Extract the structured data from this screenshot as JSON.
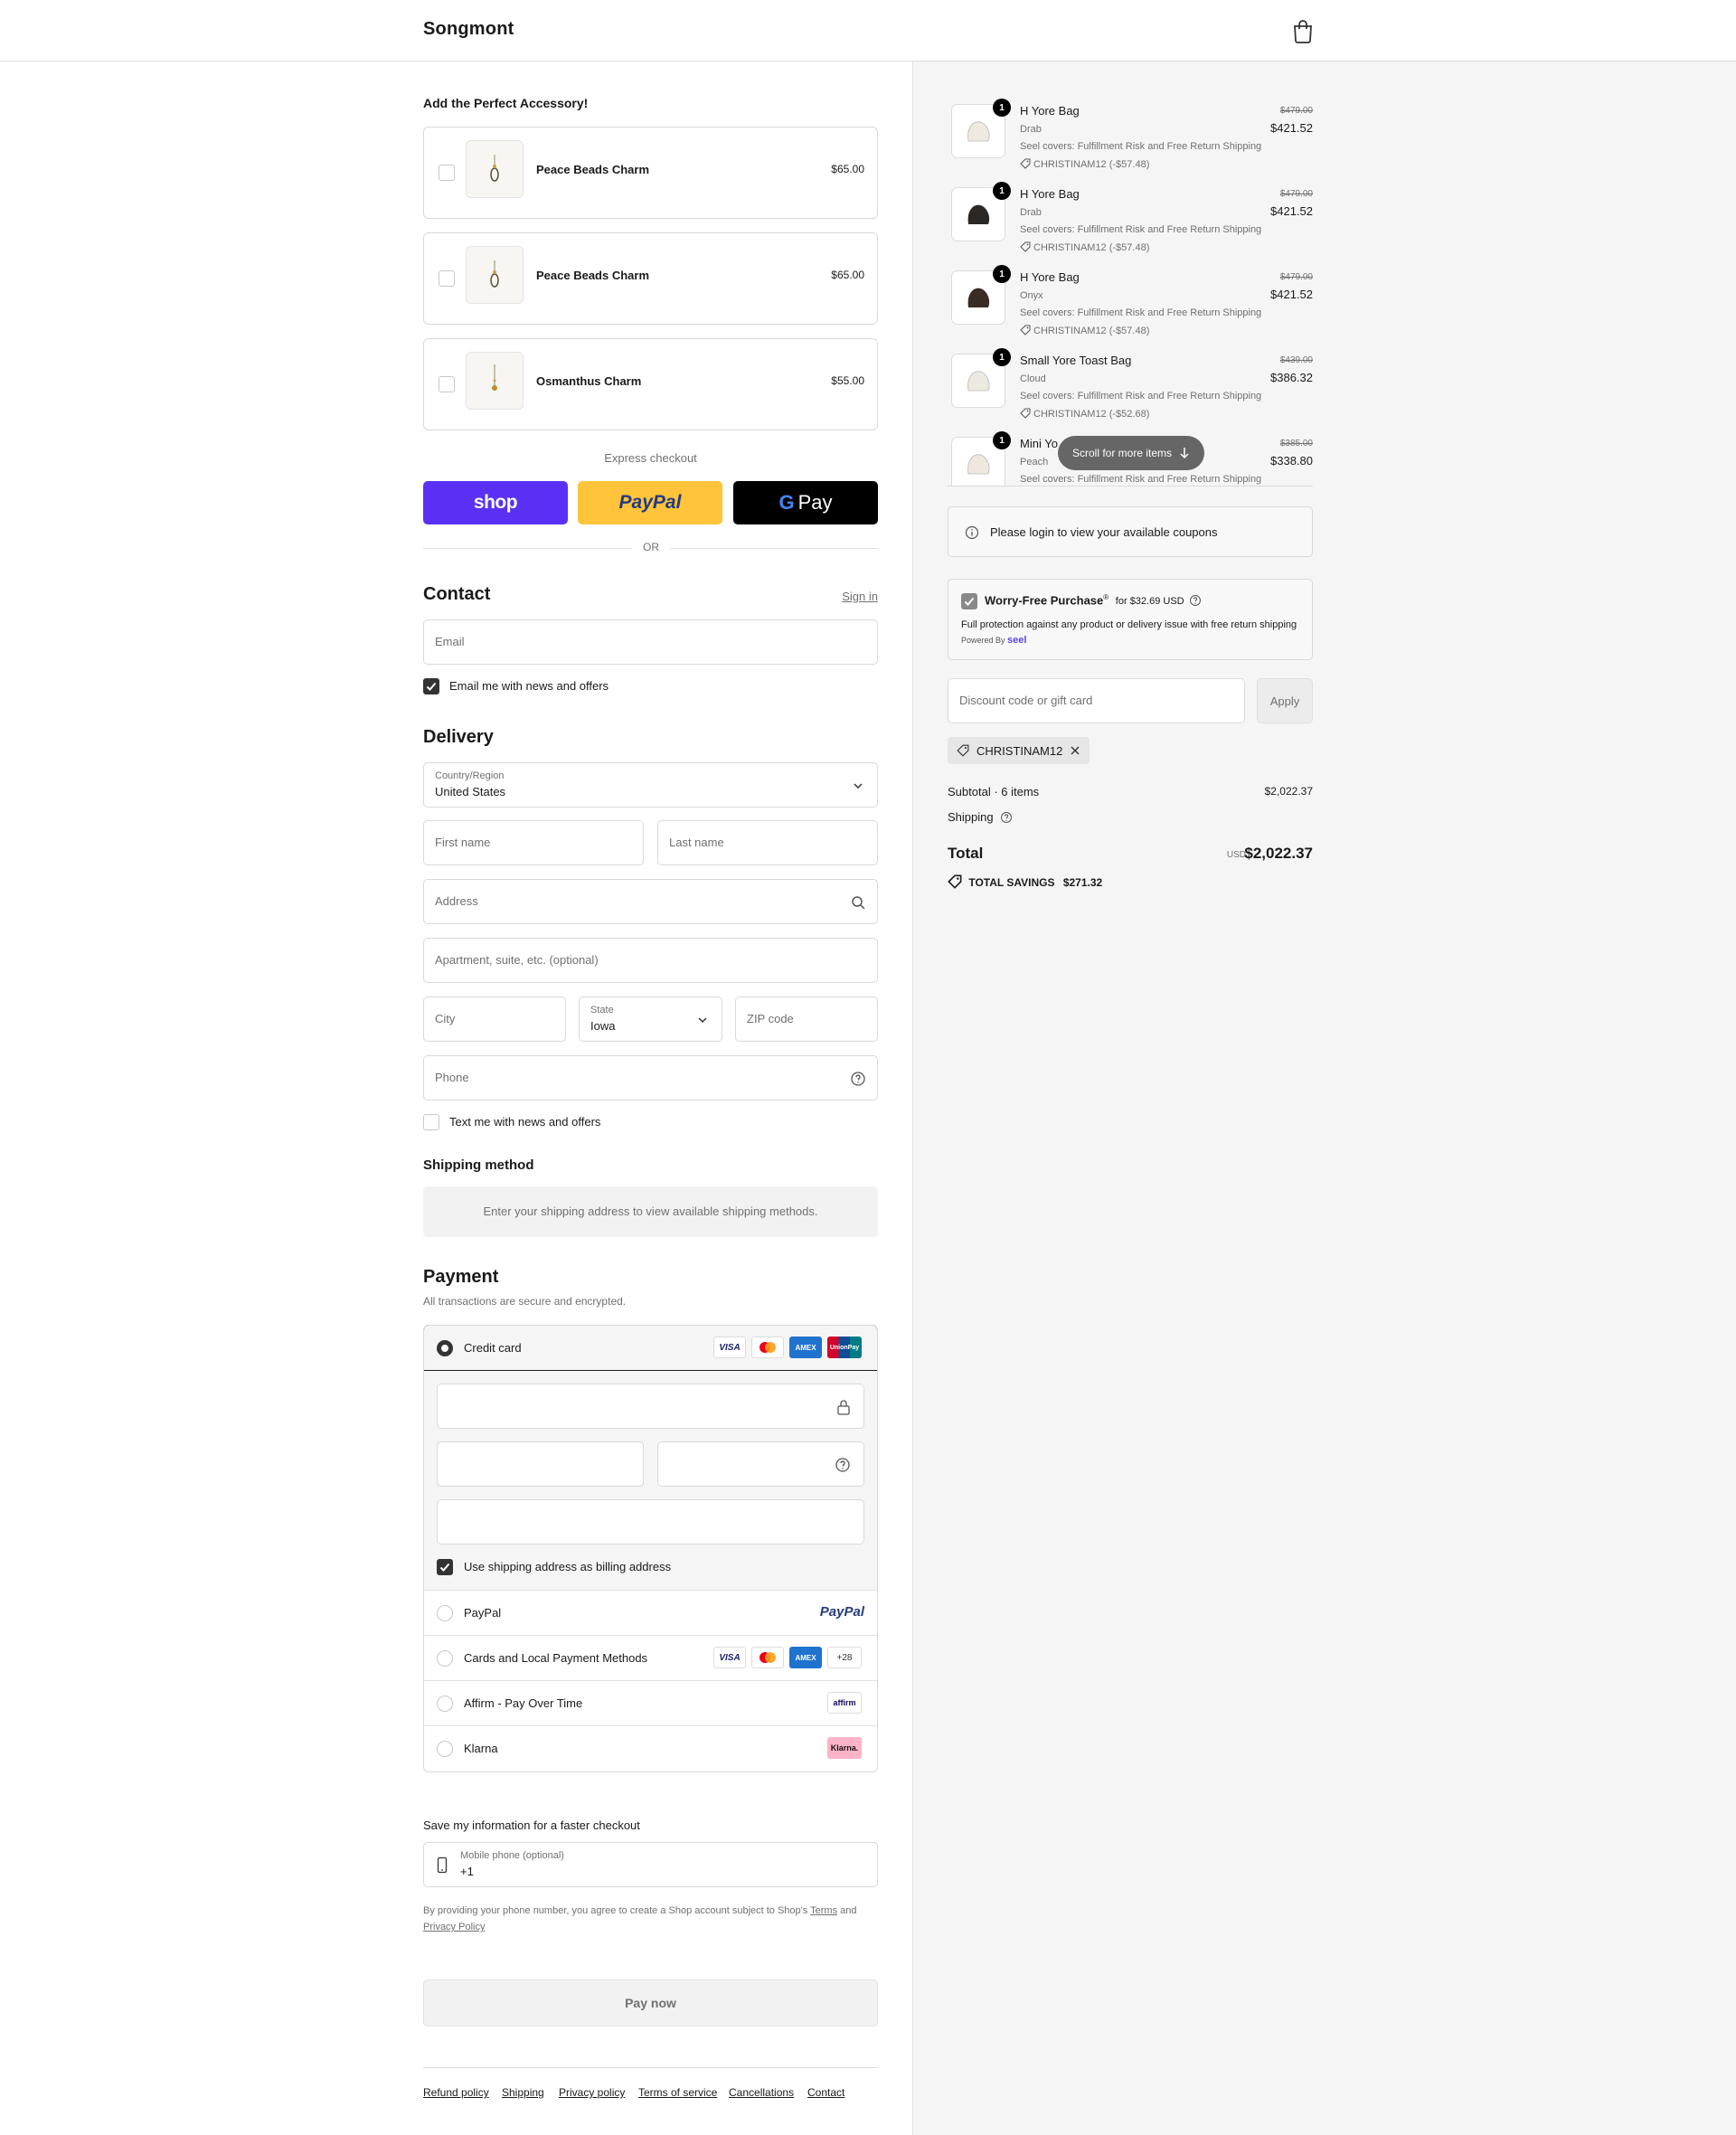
{
  "header": {
    "brand": "Songmont"
  },
  "accessories": {
    "title": "Add the Perfect Accessory!",
    "items": [
      {
        "name": "Peace Beads Charm",
        "price": "$65.00"
      },
      {
        "name": "Peace Beads Charm",
        "price": "$65.00"
      },
      {
        "name": "Osmanthus Charm",
        "price": "$55.00"
      }
    ]
  },
  "express": {
    "label": "Express checkout",
    "shop": "shop",
    "paypal": "PayPal",
    "gpay": "Pay",
    "or": "OR"
  },
  "contact": {
    "title": "Contact",
    "sign_in": "Sign in",
    "email_placeholder": "Email",
    "email_news": "Email me with news and offers"
  },
  "delivery": {
    "title": "Delivery",
    "country_label": "Country/Region",
    "country_value": "United States",
    "first_name": "First name",
    "last_name": "Last name",
    "address": "Address",
    "apartment": "Apartment, suite, etc. (optional)",
    "city": "City",
    "state_label": "State",
    "state_value": "Iowa",
    "zip": "ZIP code",
    "phone": "Phone",
    "text_news": "Text me with news and offers"
  },
  "shipping_method": {
    "title": "Shipping method",
    "message": "Enter your shipping address to view available shipping methods."
  },
  "payment": {
    "title": "Payment",
    "subtitle": "All transactions are secure and encrypted.",
    "credit_card": "Credit card",
    "billing_same": "Use shipping address as billing address",
    "paypal": "PayPal",
    "cards_local": "Cards and Local Payment Methods",
    "cards_more": "+28",
    "affirm": "Affirm - Pay Over Time",
    "klarna": "Klarna",
    "visa": "VISA",
    "amex": "AMEX",
    "unionpay": "UnionPay",
    "affirm_logo": "affirm",
    "klarna_logo": "Klarna."
  },
  "save_info": {
    "title": "Save my information for a faster checkout",
    "phone_label": "Mobile phone (optional)",
    "phone_value": "+1",
    "terms_prefix": "By providing your phone number, you agree to create a Shop account subject to Shop's",
    "terms": "Terms",
    "and": "and",
    "privacy": "Privacy Policy"
  },
  "pay_now": "Pay now",
  "footer": [
    "Refund policy",
    "Shipping",
    "Privacy policy",
    "Terms of service",
    "Cancellations",
    "Contact"
  ],
  "summary": {
    "items": [
      {
        "qty": "1",
        "name": "H Yore Bag",
        "variant": "Drab",
        "seel": "Seel covers: Fulfillment Risk and Free Return Shipping",
        "discount": "CHRISTINAM12 (-$57.48)",
        "old_price": "$479.00",
        "price": "$421.52",
        "color": "#eeeae2"
      },
      {
        "qty": "1",
        "name": "H Yore Bag",
        "variant": "Drab",
        "seel": "Seel covers: Fulfillment Risk and Free Return Shipping",
        "discount": "CHRISTINAM12 (-$57.48)",
        "old_price": "$479.00",
        "price": "$421.52",
        "color": "#2b2724"
      },
      {
        "qty": "1",
        "name": "H Yore Bag",
        "variant": "Onyx",
        "seel": "Seel covers: Fulfillment Risk and Free Return Shipping",
        "discount": "CHRISTINAM12 (-$57.48)",
        "old_price": "$479.00",
        "price": "$421.52",
        "color": "#3a2a24"
      },
      {
        "qty": "1",
        "name": "Small Yore Toast Bag",
        "variant": "Cloud",
        "seel": "Seel covers: Fulfillment Risk and Free Return Shipping",
        "discount": "CHRISTINAM12 (-$52.68)",
        "old_price": "$439.00",
        "price": "$386.32",
        "color": "#ece9e0"
      },
      {
        "qty": "1",
        "name": "Mini Yo",
        "variant": "Peach",
        "seel": "Seel covers: Fulfillment Risk and Free Return Shipping",
        "discount": "",
        "old_price": "$385.00",
        "price": "$338.80",
        "color": "#efe8df"
      }
    ],
    "scroll_hint": "Scroll for more items",
    "coupon_msg": "Please login to view your available coupons",
    "worry": {
      "title": "Worry-Free Purchase",
      "sup": "®",
      "price": "for $32.69 USD",
      "desc": "Full protection against any product or delivery issue with free return shipping",
      "powered": "Powered By",
      "brand": "seel"
    },
    "discount_placeholder": "Discount code or gift card",
    "apply": "Apply",
    "applied_code": "CHRISTINAM12",
    "subtotal_label": "Subtotal · 6 items",
    "subtotal_value": "$2,022.37",
    "shipping_label": "Shipping",
    "total_label": "Total",
    "currency": "USD",
    "total_value": "$2,022.37",
    "savings_label": "TOTAL SAVINGS",
    "savings_value": "$271.32"
  }
}
